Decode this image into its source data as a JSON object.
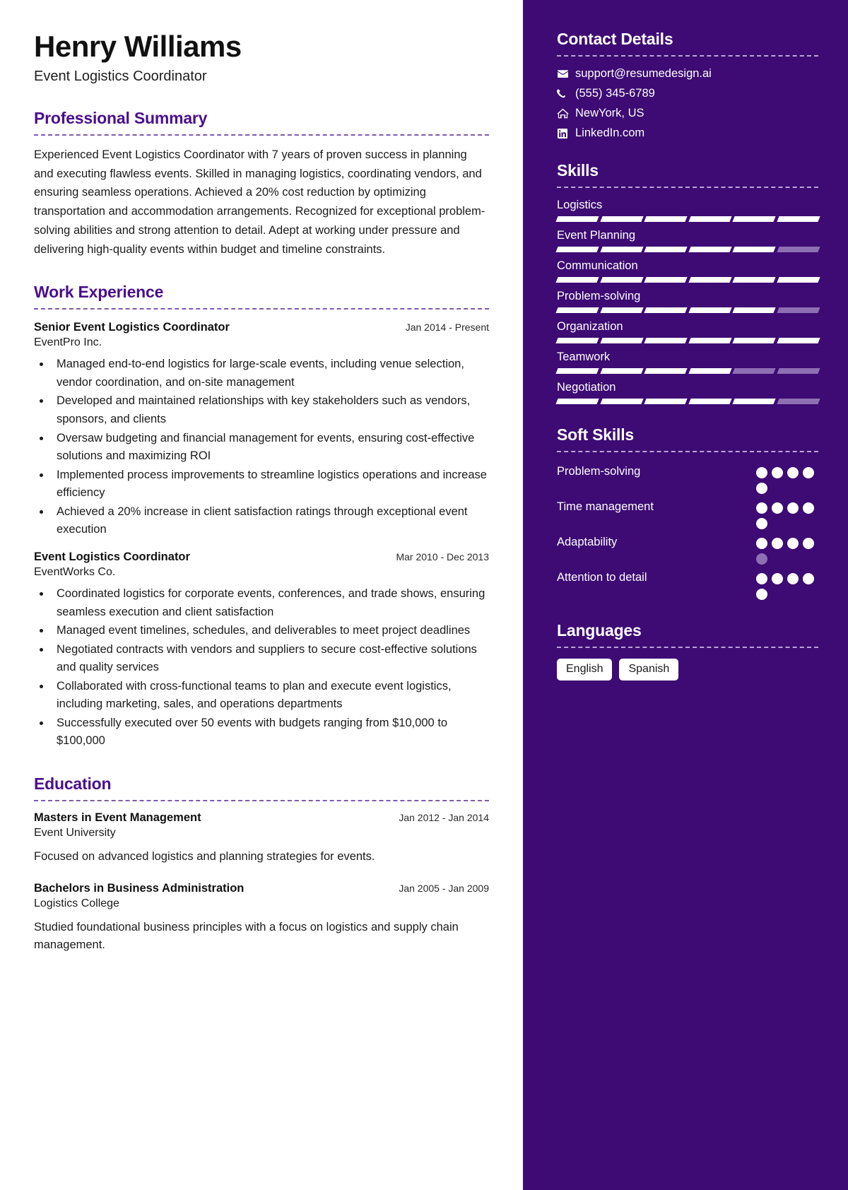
{
  "header": {
    "name": "Henry Williams",
    "job_title": "Event Logistics Coordinator"
  },
  "theme": {
    "accent_purple": "#4B0F8C",
    "sidebar_bg": "#3D0B73",
    "bar_filled": "#FFFFFF",
    "bar_empty": "#8E6FB4"
  },
  "summary": {
    "heading": "Professional Summary",
    "text": "Experienced Event Logistics Coordinator with 7 years of proven success in planning and executing flawless events. Skilled in managing logistics, coordinating vendors, and ensuring seamless operations. Achieved a 20% cost reduction by optimizing transportation and accommodation arrangements. Recognized for exceptional problem-solving abilities and strong attention to detail. Adept at working under pressure and delivering high-quality events within budget and timeline constraints."
  },
  "work": {
    "heading": "Work Experience",
    "entries": [
      {
        "title": "Senior Event Logistics Coordinator",
        "date": "Jan 2014 - Present",
        "org": "EventPro Inc.",
        "bullets": [
          "Managed end-to-end logistics for large-scale events, including venue selection, vendor coordination, and on-site management",
          "Developed and maintained relationships with key stakeholders such as vendors, sponsors, and clients",
          "Oversaw budgeting and financial management for events, ensuring cost-effective solutions and maximizing ROI",
          "Implemented process improvements to streamline logistics operations and increase efficiency",
          "Achieved a 20% increase in client satisfaction ratings through exceptional event execution"
        ]
      },
      {
        "title": "Event Logistics Coordinator",
        "date": "Mar 2010 - Dec 2013",
        "org": "EventWorks Co.",
        "bullets": [
          "Coordinated logistics for corporate events, conferences, and trade shows, ensuring seamless execution and client satisfaction",
          "Managed event timelines, schedules, and deliverables to meet project deadlines",
          "Negotiated contracts with vendors and suppliers to secure cost-effective solutions and quality services",
          "Collaborated with cross-functional teams to plan and execute event logistics, including marketing, sales, and operations departments",
          "Successfully executed over 50 events with budgets ranging from $10,000 to $100,000"
        ]
      }
    ]
  },
  "education": {
    "heading": "Education",
    "entries": [
      {
        "degree": "Masters in Event Management",
        "date": "Jan 2012 - Jan 2014",
        "school": "Event University",
        "description": "Focused on advanced logistics and planning strategies for events."
      },
      {
        "degree": "Bachelors in Business Administration",
        "date": "Jan 2005 - Jan 2009",
        "school": "Logistics College",
        "description": "Studied foundational business principles with a focus on logistics and supply chain management."
      }
    ]
  },
  "contact": {
    "heading": "Contact Details",
    "items": [
      {
        "icon": "envelope-icon",
        "value": "support@resumedesign.ai"
      },
      {
        "icon": "phone-icon",
        "value": "(555) 345-6789"
      },
      {
        "icon": "home-icon",
        "value": "NewYork, US"
      },
      {
        "icon": "linkedin-icon",
        "value": "LinkedIn.com"
      }
    ]
  },
  "skills": {
    "heading": "Skills",
    "segments_total": 6,
    "items": [
      {
        "name": "Logistics",
        "filled": 6
      },
      {
        "name": "Event Planning",
        "filled": 5
      },
      {
        "name": "Communication",
        "filled": 6
      },
      {
        "name": "Problem-solving",
        "filled": 5
      },
      {
        "name": "Organization",
        "filled": 6
      },
      {
        "name": "Teamwork",
        "filled": 4
      },
      {
        "name": "Negotiation",
        "filled": 5
      }
    ]
  },
  "soft_skills": {
    "heading": "Soft Skills",
    "dots_total": 5,
    "items": [
      {
        "name": "Problem-solving",
        "filled": 5
      },
      {
        "name": "Time management",
        "filled": 5
      },
      {
        "name": "Adaptability",
        "filled": 4
      },
      {
        "name": "Attention to detail",
        "filled": 5
      }
    ]
  },
  "languages": {
    "heading": "Languages",
    "items": [
      "English",
      "Spanish"
    ]
  }
}
